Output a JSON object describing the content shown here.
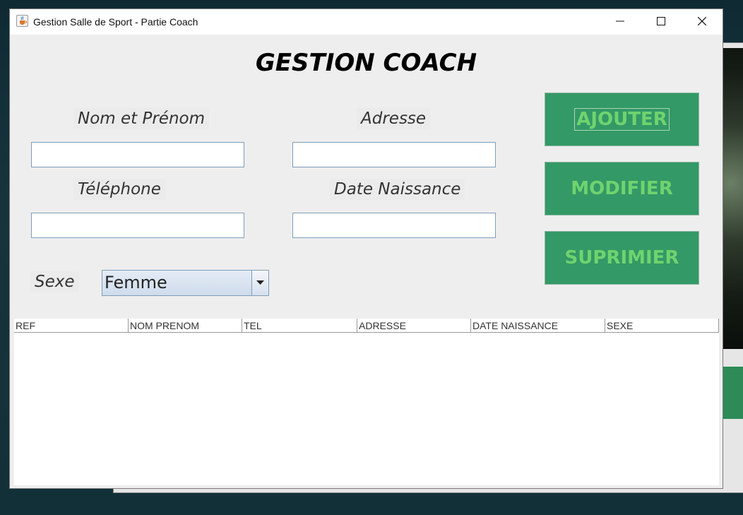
{
  "window": {
    "title": "Gestion Salle de Sport - Partie Coach"
  },
  "form": {
    "heading": "GESTION COACH",
    "labels": {
      "nom_prenom": "Nom et Prénom",
      "adresse": "Adresse",
      "telephone": "Téléphone",
      "date_naissance": "Date Naissance",
      "sexe": "Sexe"
    },
    "values": {
      "nom_prenom": "",
      "adresse": "",
      "telephone": "",
      "date_naissance": "",
      "sexe": "Femme"
    }
  },
  "actions": {
    "add": "AJOUTER",
    "modify": "MODIFIER",
    "delete": "SUPRIMIER"
  },
  "table": {
    "columns": [
      "REF",
      "NOM PRENOM",
      "TEL",
      "ADRESSE",
      "DATE NAISSANCE",
      "SEXE"
    ],
    "rows": []
  },
  "colors": {
    "button_bg": "#339966",
    "button_text": "#6fd36f"
  },
  "icons": {
    "app": "java-cup-icon",
    "minimize": "minimize-icon",
    "maximize": "maximize-icon",
    "close": "close-icon",
    "dropdown": "chevron-down-icon"
  }
}
